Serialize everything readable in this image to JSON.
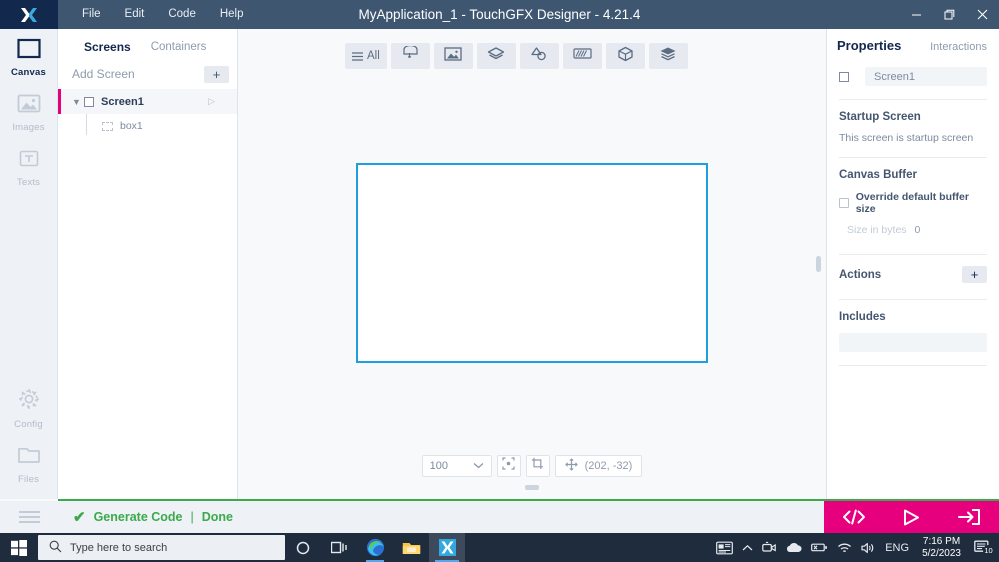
{
  "window": {
    "title": "MyApplication_1 - TouchGFX Designer - 4.21.4",
    "logo_icon": "touchgfx-logo-icon",
    "minimize_icon": "minimize-icon",
    "maximize_icon": "restore-icon",
    "close_icon": "close-icon",
    "menu": [
      {
        "label": "File"
      },
      {
        "label": "Edit"
      },
      {
        "label": "Code"
      },
      {
        "label": "Help"
      }
    ]
  },
  "rail": {
    "items": [
      {
        "label": "Canvas",
        "icon": "canvas-icon",
        "active": true
      },
      {
        "label": "Images",
        "icon": "images-icon",
        "active": false
      },
      {
        "label": "Texts",
        "icon": "texts-icon",
        "active": false
      }
    ],
    "bottom_items": [
      {
        "label": "Config",
        "icon": "gear-icon"
      },
      {
        "label": "Files",
        "icon": "folder-icon"
      }
    ]
  },
  "tree": {
    "tabs": [
      {
        "label": "Screens",
        "active": true
      },
      {
        "label": "Containers",
        "active": false
      }
    ],
    "add_screen_label": "Add Screen",
    "add_button_label": "+",
    "screen": {
      "label": "Screen1",
      "caret_icon": "chevron-down-icon",
      "checkbox_icon": "checkbox-icon",
      "play_icon": "play-icon"
    },
    "children": [
      {
        "label": "box1",
        "icon": "box-widget-icon"
      }
    ]
  },
  "toolbar": {
    "items": [
      {
        "label": "All",
        "icon": "list-all-icon"
      },
      {
        "label": "",
        "icon": "button-widget-icon"
      },
      {
        "label": "",
        "icon": "image-widget-icon"
      },
      {
        "label": "",
        "icon": "shape-layers-icon"
      },
      {
        "label": "",
        "icon": "drawing-shapes-icon"
      },
      {
        "label": "",
        "icon": "progress-gauge-icon"
      },
      {
        "label": "",
        "icon": "cube-3d-icon"
      },
      {
        "label": "",
        "icon": "containers-stack-icon"
      }
    ]
  },
  "canvas": {
    "border_color": "#1fa0dd",
    "background_color": "#ffffff",
    "zoom_value": "100",
    "zoom_caret_icon": "chevron-down-icon",
    "center_icon": "center-target-icon",
    "crop_icon": "crop-icon",
    "move_icon": "move-cross-icon",
    "coordinates": "(202, -32)"
  },
  "properties": {
    "tabs": [
      {
        "label": "Properties",
        "active": true
      },
      {
        "label": "Interactions",
        "active": false
      }
    ],
    "name_checkbox_icon": "checkbox-icon",
    "name_value": "Screen1",
    "sections": [
      {
        "title": "Startup Screen",
        "text": "This screen is startup screen"
      },
      {
        "title": "Canvas Buffer",
        "checkbox_label": "Override default buffer size",
        "size_label": "Size in bytes",
        "size_value": "0"
      },
      {
        "title": "Actions",
        "add_button_label": "+"
      },
      {
        "title": "Includes"
      }
    ]
  },
  "status": {
    "hamburger_icon": "hamburger-icon",
    "check_icon": "check-icon",
    "generate_code_label": "Generate Code",
    "separator": "|",
    "done_label": "Done",
    "accent_color": "#3aaa4a",
    "action_bar_color": "#e6007e",
    "actions": [
      {
        "icon": "code-brackets-icon"
      },
      {
        "icon": "play-run-icon"
      },
      {
        "icon": "export-arrow-icon"
      }
    ]
  },
  "taskbar": {
    "start_icon": "windows-start-icon",
    "search_icon": "search-icon",
    "search_placeholder": "Type here to search",
    "apps": [
      {
        "icon": "cortana-circle-icon",
        "state": "idle"
      },
      {
        "icon": "task-view-icon",
        "state": "idle"
      },
      {
        "icon": "edge-browser-icon",
        "state": "open"
      },
      {
        "icon": "file-explorer-icon",
        "state": "idle"
      },
      {
        "icon": "touchgfx-app-icon",
        "state": "active"
      }
    ],
    "tray": [
      {
        "icon": "news-weather-icon"
      },
      {
        "icon": "chevron-up-icon"
      },
      {
        "icon": "meet-now-icon"
      },
      {
        "icon": "onedrive-cloud-icon"
      },
      {
        "icon": "battery-icon"
      },
      {
        "icon": "wifi-icon"
      },
      {
        "icon": "volume-icon"
      }
    ],
    "language": "ENG",
    "time": "7:16 PM",
    "date": "5/2/2023",
    "notification_icon": "notification-icon",
    "notification_count": "10"
  }
}
